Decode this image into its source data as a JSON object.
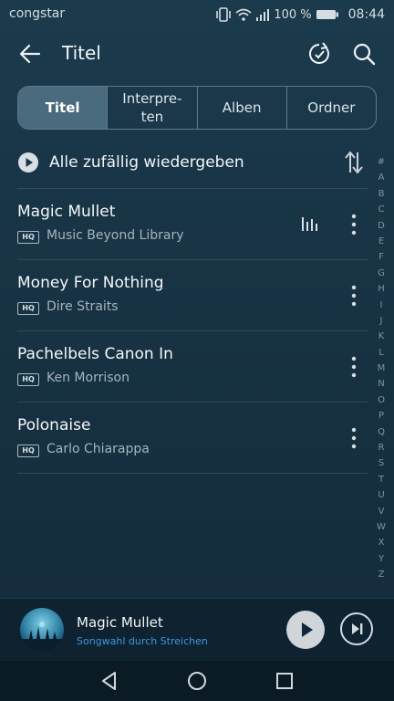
{
  "status_bar": {
    "carrier": "congstar",
    "battery": "100 %",
    "time": "08:44",
    "icons": [
      "vibrate-icon",
      "wifi-icon",
      "signal-icon",
      "battery-icon"
    ]
  },
  "header": {
    "title": "Titel",
    "icons": [
      "back-arrow-icon",
      "sync-icon",
      "search-icon"
    ]
  },
  "tabs": [
    {
      "label": "Titel",
      "selected": true
    },
    {
      "label": "Interpre-\nten",
      "selected": false
    },
    {
      "label": "Alben",
      "selected": false
    },
    {
      "label": "Ordner",
      "selected": false
    }
  ],
  "shuffle": {
    "label": "Alle zufällig wiedergeben"
  },
  "songs": [
    {
      "title": "Magic Mullet",
      "badge": "HQ",
      "artist": "Music Beyond Library",
      "playing": true
    },
    {
      "title": "Money For Nothing",
      "badge": "HQ",
      "artist": "Dire Straits",
      "playing": false
    },
    {
      "title": "Pachelbels Canon In",
      "badge": "HQ",
      "artist": "Ken Morrison",
      "playing": false
    },
    {
      "title": "Polonaise",
      "badge": "HQ",
      "artist": "Carlo Chiarappa",
      "playing": false
    }
  ],
  "alphabet": [
    "#",
    "A",
    "B",
    "C",
    "D",
    "E",
    "F",
    "G",
    "H",
    "I",
    "J",
    "K",
    "L",
    "M",
    "N",
    "O",
    "P",
    "Q",
    "R",
    "S",
    "T",
    "U",
    "V",
    "W",
    "X",
    "Y",
    "Z"
  ],
  "now_playing": {
    "title": "Magic Mullet",
    "hint": "Songwahl durch Streichen"
  },
  "colors": {
    "background": "#173243",
    "selected_tab": "#4a6a7d",
    "accent_hint": "#3f97df"
  }
}
